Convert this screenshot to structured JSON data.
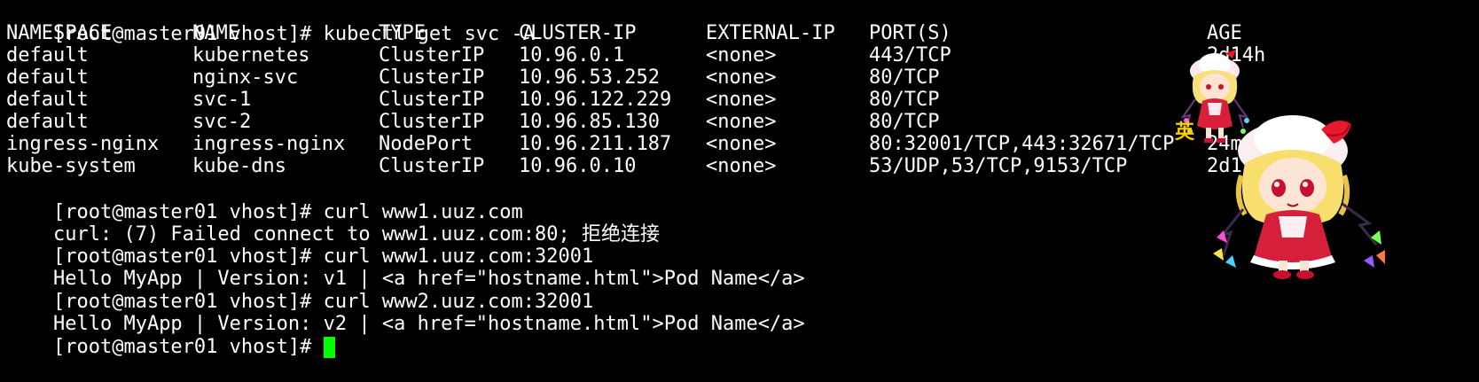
{
  "terminal": {
    "background": "#000000",
    "foreground": "#ffffff",
    "cursor_color": "#00ff00",
    "prompt": "[root@master01 vhost]# ",
    "cmd_get_svc": "kubectl get svc -A",
    "cmd_curl_1": "curl www1.uuz.com",
    "out_curl_1": "curl: (7) Failed connect to www1.uuz.com:80; 拒绝连接",
    "cmd_curl_2": "curl www1.uuz.com:32001",
    "out_curl_2": "Hello MyApp | Version: v1 | <a href=\"hostname.html\">Pod Name</a>",
    "cmd_curl_3": "curl www2.uuz.com:32001",
    "out_curl_3": "Hello MyApp | Version: v2 | <a href=\"hostname.html\">Pod Name</a>"
  },
  "svc_table": {
    "headers": [
      "NAMESPACE",
      "NAME",
      "TYPE",
      "CLUSTER-IP",
      "EXTERNAL-IP",
      "PORT(S)",
      "AGE"
    ],
    "rows": [
      [
        "default",
        "kubernetes",
        "ClusterIP",
        "10.96.0.1",
        "<none>",
        "443/TCP",
        "2d14h"
      ],
      [
        "default",
        "nginx-svc",
        "ClusterIP",
        "10.96.53.252",
        "<none>",
        "80/TCP",
        ""
      ],
      [
        "default",
        "svc-1",
        "ClusterIP",
        "10.96.122.229",
        "<none>",
        "80/TCP",
        ""
      ],
      [
        "default",
        "svc-2",
        "ClusterIP",
        "10.96.85.130",
        "<none>",
        "80/TCP",
        ""
      ],
      [
        "ingress-nginx",
        "ingress-nginx",
        "NodePort",
        "10.96.211.187",
        "<none>",
        "80:32001/TCP,443:32671/TCP",
        "24m"
      ],
      [
        "kube-system",
        "kube-dns",
        "ClusterIP",
        "10.96.0.10",
        "<none>",
        "53/UDP,53/TCP,9153/TCP",
        "2d1"
      ]
    ]
  },
  "overlay": {
    "glyph": "英"
  }
}
